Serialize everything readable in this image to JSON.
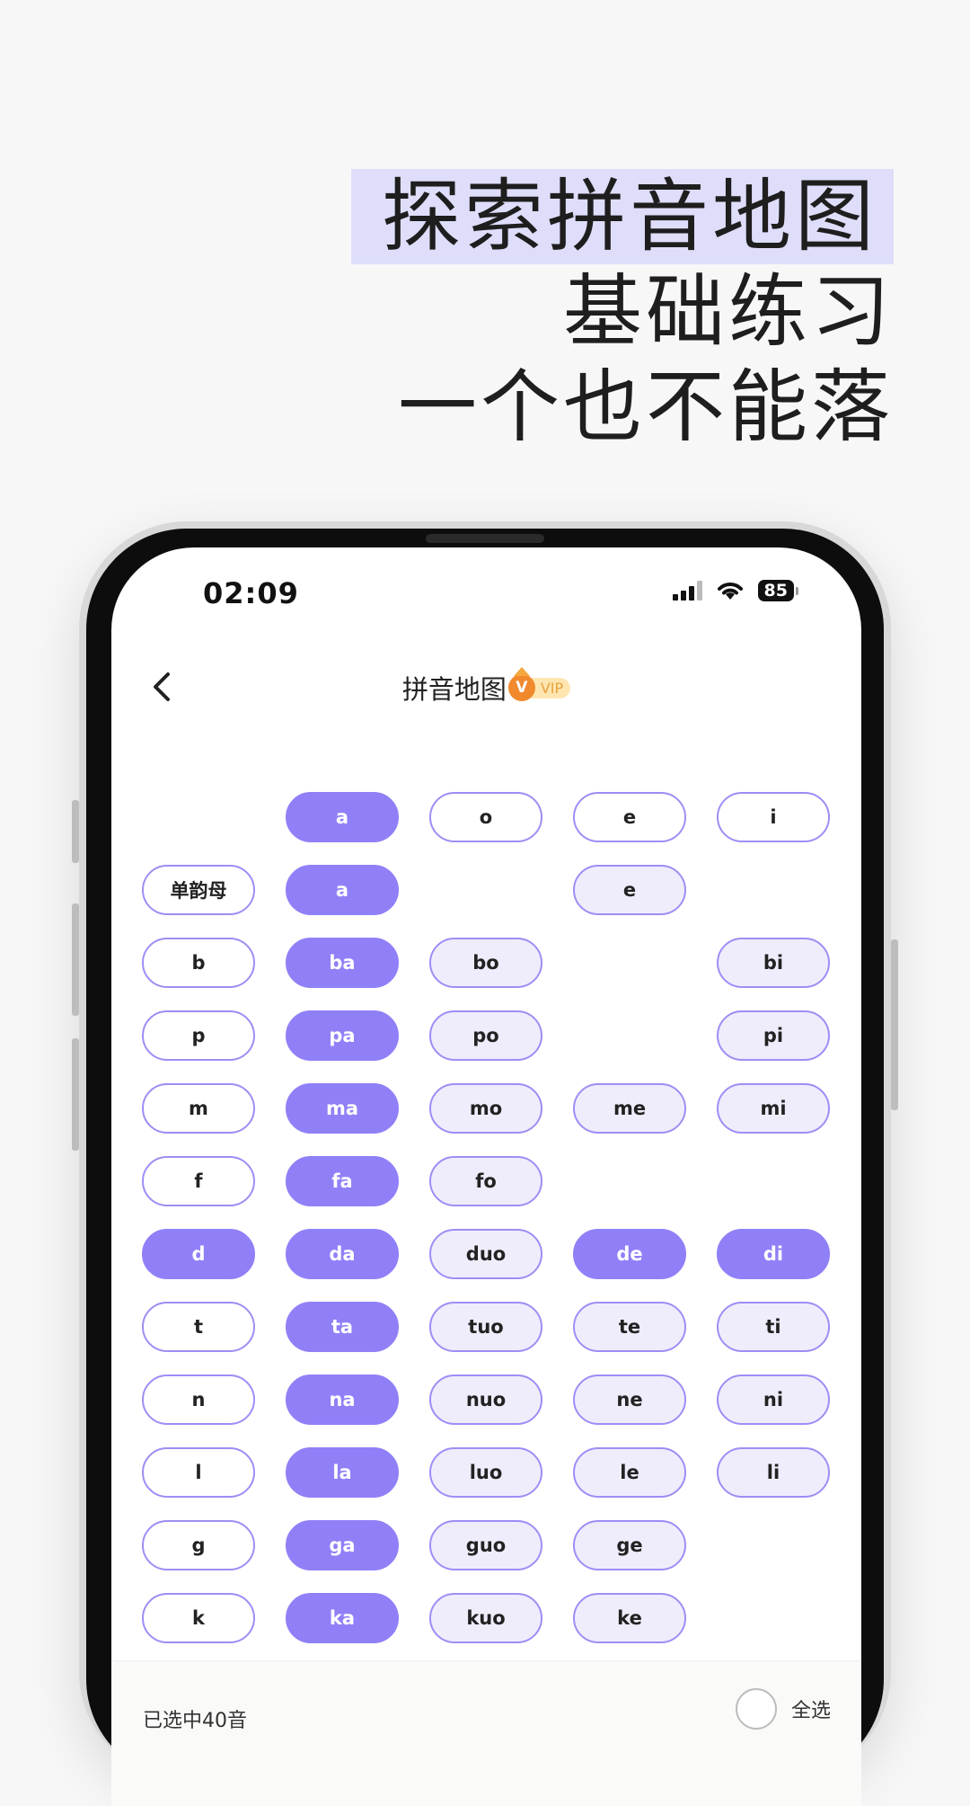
{
  "headline": {
    "line1": "探索拼音地图",
    "line2": "基础练习",
    "line3": "一个也不能落"
  },
  "status_bar": {
    "time": "02:09",
    "battery": "85"
  },
  "nav": {
    "title": "拼音地图",
    "vip_icon_letter": "V",
    "vip_label": "VIP"
  },
  "grid": {
    "rows": [
      [
        "",
        "a",
        "o",
        "e",
        "i"
      ],
      [
        "单韵母",
        "a",
        "",
        "e",
        ""
      ],
      [
        "b",
        "ba",
        "bo",
        "",
        "bi"
      ],
      [
        "p",
        "pa",
        "po",
        "",
        "pi"
      ],
      [
        "m",
        "ma",
        "mo",
        "me",
        "mi"
      ],
      [
        "f",
        "fa",
        "fo",
        "",
        ""
      ],
      [
        "d",
        "da",
        "duo",
        "de",
        "di"
      ],
      [
        "t",
        "ta",
        "tuo",
        "te",
        "ti"
      ],
      [
        "n",
        "na",
        "nuo",
        "ne",
        "ni"
      ],
      [
        "l",
        "la",
        "luo",
        "le",
        "li"
      ],
      [
        "g",
        "ga",
        "guo",
        "ge",
        ""
      ],
      [
        "k",
        "ka",
        "kuo",
        "ke",
        ""
      ]
    ],
    "styles": [
      [
        "",
        "f",
        "w",
        "w",
        "w"
      ],
      [
        "w",
        "f",
        "",
        "l",
        ""
      ],
      [
        "w",
        "f",
        "l",
        "",
        "l"
      ],
      [
        "w",
        "f",
        "l",
        "",
        "l"
      ],
      [
        "w",
        "f",
        "l",
        "l",
        "l"
      ],
      [
        "w",
        "f",
        "l",
        "",
        ""
      ],
      [
        "f",
        "f",
        "l",
        "f",
        "f"
      ],
      [
        "w",
        "f",
        "l",
        "l",
        "l"
      ],
      [
        "w",
        "f",
        "l",
        "l",
        "l"
      ],
      [
        "w",
        "f",
        "l",
        "l",
        "l"
      ],
      [
        "w",
        "f",
        "l",
        "l",
        ""
      ],
      [
        "w",
        "f",
        "l",
        "l",
        ""
      ]
    ],
    "colors": {
      "selected": "#9080f7",
      "light": "#efedfc",
      "border": "#9d8ef5"
    }
  },
  "bottom_bar": {
    "selected_count": "已选中40音",
    "select_all": "全选"
  }
}
